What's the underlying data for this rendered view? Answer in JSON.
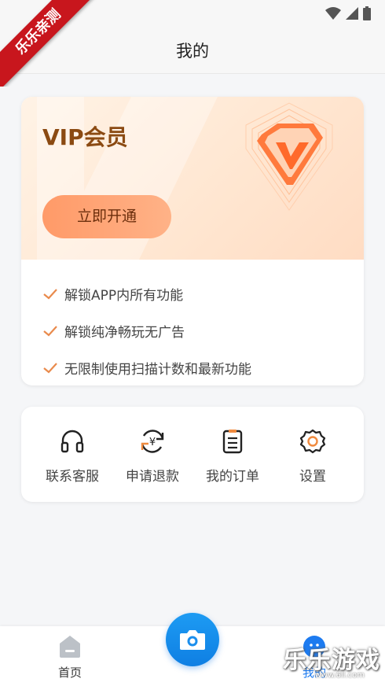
{
  "watermark": {
    "text": "乐乐亲测"
  },
  "header": {
    "title": "我的"
  },
  "vip": {
    "title": "VIP会员",
    "button": "立即开通",
    "benefits": [
      "解锁APP内所有功能",
      "解锁纯净畅玩无广告",
      "无限制使用扫描计数和最新功能"
    ]
  },
  "menu": {
    "items": [
      {
        "label": "联系客服",
        "icon": "headset-icon"
      },
      {
        "label": "申请退款",
        "icon": "refund-icon"
      },
      {
        "label": "我的订单",
        "icon": "order-list-icon"
      },
      {
        "label": "设置",
        "icon": "gear-icon"
      }
    ]
  },
  "tabbar": {
    "home": "首页",
    "mine": "我的"
  },
  "corner_watermark": {
    "text": "乐乐游戏",
    "url": "www.6ll.com"
  },
  "colors": {
    "accent": "#1d9bf3",
    "vip_text": "#8b4a12",
    "button_orange": "#ff9a68",
    "check": "#e98a4c"
  }
}
